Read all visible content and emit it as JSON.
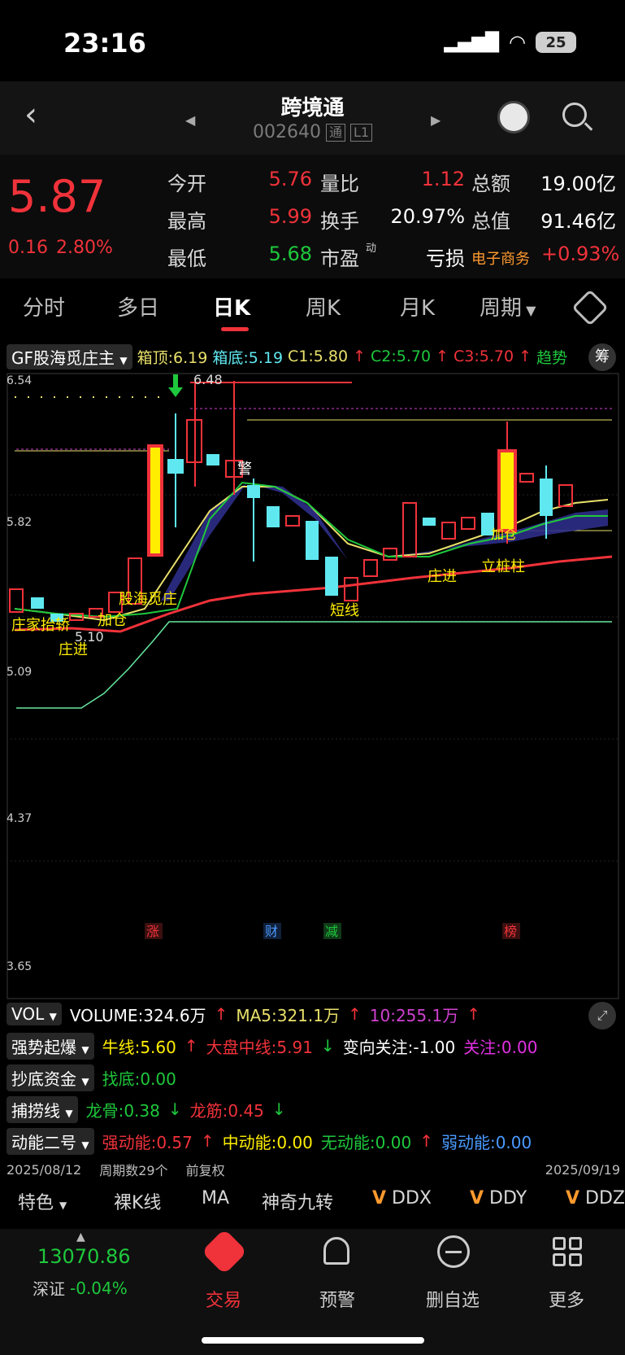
{
  "status": {
    "time": "23:16",
    "battery": "25"
  },
  "header": {
    "title": "跨境通",
    "code": "002640",
    "tag1": "通",
    "tag2": "L1"
  },
  "quote": {
    "price": "5.87",
    "change": "0.16",
    "change_pct": "2.80%",
    "labels": [
      "今开",
      "量比",
      "总额",
      "最高",
      "换手",
      "总值",
      "最低",
      "市盈",
      "亏损"
    ],
    "open": "5.76",
    "vol_ratio": "1.12",
    "amount": "19.00亿",
    "high": "5.99",
    "turnover": "20.97%",
    "market_cap": "91.46亿",
    "low": "5.68",
    "pe_sup": "动",
    "sector": "电子商务",
    "sector_change": "+0.93%"
  },
  "tabs": [
    "分时",
    "多日",
    "日K",
    "周K",
    "月K",
    "周期"
  ],
  "indicator": {
    "selector": "GF股海觅庄主",
    "box_top": "箱顶:6.19",
    "box_bottom": "箱底:5.19",
    "c1": "C1:5.80",
    "c2": "C2:5.70",
    "c3": "C3:5.70",
    "trend": "趋势",
    "chip": "筹"
  },
  "chart": {
    "axis": [
      "6.54",
      "5.82",
      "5.09",
      "4.37",
      "3.65"
    ],
    "high_label": "6.48",
    "low_label": "5.10",
    "annotations": [
      "庄家抬轿",
      "庄进",
      "加仓",
      "股海觅庄",
      "警",
      "短线",
      "庄进",
      "立桩柱",
      "加仓"
    ],
    "markers": [
      "涨",
      "财",
      "减",
      "榜"
    ],
    "colors": {
      "up": "#f0323a",
      "down": "#5fe8f0",
      "ma_yellow": "#e8e06a",
      "ma_green": "#1ec83c",
      "band": "#2e2e88"
    }
  },
  "vol": {
    "selector": "VOL",
    "volume": "VOLUME:324.6万",
    "ma5": "MA5:321.1万",
    "ma10": "10:255.1万"
  },
  "strong": {
    "selector": "强势起爆",
    "a": "牛线:5.60",
    "b": "大盘中线:5.91",
    "c": "变向关注:-1.00",
    "d": "关注:0.00"
  },
  "bottom_fund": {
    "selector": "抄底资金",
    "a": "找底:0.00"
  },
  "catch": {
    "selector": "捕捞线",
    "a": "龙骨:0.38",
    "b": "龙筋:0.45"
  },
  "momentum": {
    "selector": "动能二号",
    "a": "强动能:0.57",
    "b": "中动能:0.00",
    "c": "无动能:0.00",
    "d": "弱动能:0.00"
  },
  "dates": {
    "start": "2025/08/12",
    "count": "周期数29个",
    "adj": "前复权",
    "end": "2025/09/19"
  },
  "bottom_tabs": [
    "特色",
    "裸K线",
    "MA",
    "神奇九转",
    "DDX",
    "DDY",
    "DDZ"
  ],
  "nav": {
    "index_value": "13070.86",
    "index_name": "深证",
    "index_change": "-0.04%",
    "items": [
      "交易",
      "预警",
      "删自选",
      "更多"
    ]
  }
}
